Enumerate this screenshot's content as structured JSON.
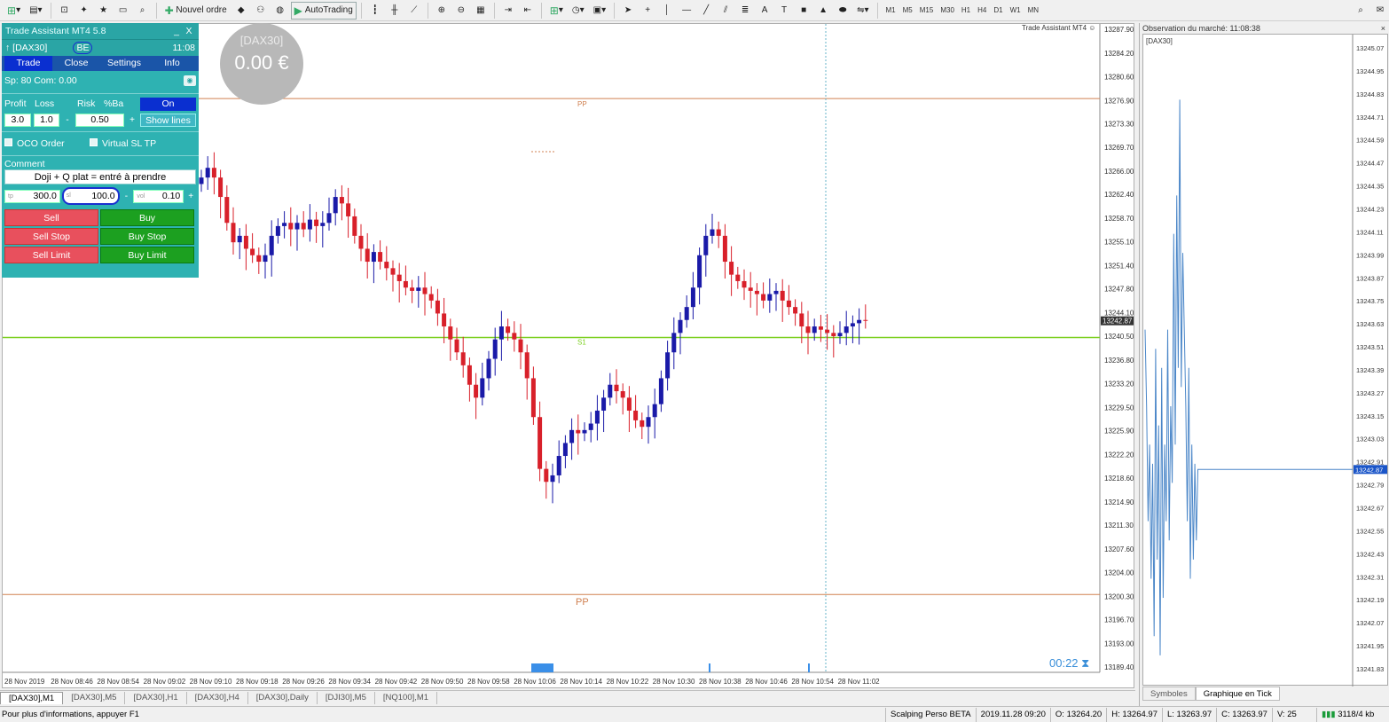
{
  "toolbar": {
    "new_order_label": "Nouvel ordre",
    "autotrading_label": "AutoTrading",
    "timeframes": [
      "M1",
      "M5",
      "M15",
      "M30",
      "H1",
      "H4",
      "D1",
      "W1",
      "MN"
    ]
  },
  "trade_assistant": {
    "title": "Trade Assistant MT4 5.8",
    "minimize": "_",
    "close": "X",
    "symbol": "[DAX30]",
    "be_label": "BE",
    "time": "11:08",
    "tabs": [
      "Trade",
      "Close",
      "Settings",
      "Info"
    ],
    "spread_text": "Sp: 80  Com: 0.00",
    "headers": {
      "profit": "Profit",
      "loss": "Loss",
      "risk": "Risk",
      "pct_ba": "%Ba"
    },
    "on_label": "On",
    "profit_value": "3.0",
    "loss_value": "1.0",
    "risk_minus": "-",
    "risk_value": "0.50",
    "risk_plus": "+",
    "show_lines_label": "Show lines",
    "oco_label": "OCO Order",
    "virtual_label": "Virtual SL TP",
    "comment_label": "Comment",
    "comment_value": "Doji + Q plat = entré à prendre",
    "tp_label": "tp",
    "tp_value": "300.0",
    "sl_label": "sl",
    "sl_value": "100.0",
    "vol_label": "vol",
    "vol_minus": "-",
    "vol_value": "0.10",
    "vol_plus": "+",
    "buttons": {
      "sell": "Sell",
      "buy": "Buy",
      "sell_stop": "Sell Stop",
      "buy_stop": "Buy Stop",
      "sell_limit": "Sell Limit",
      "buy_limit": "Buy Limit"
    }
  },
  "pnl_badge": {
    "symbol": "[DAX30]",
    "value": "0.00 €"
  },
  "chart": {
    "ea_label": "Trade Assistant MT4",
    "pp_top_label": "PP",
    "pp_bottom_label": "PP",
    "s1_label": "S1",
    "timer": "00:22",
    "current_price_label": "13242.87",
    "colors": {
      "bull": "#1a1aa8",
      "bear": "#d8202a",
      "pp": "#d08050",
      "s1": "#7cd020"
    },
    "y_ticks": [
      "13287.90",
      "13284.20",
      "13280.60",
      "13276.90",
      "13273.30",
      "13269.70",
      "13266.00",
      "13262.40",
      "13258.70",
      "13255.10",
      "13251.40",
      "13247.80",
      "13244.10",
      "13240.50",
      "13236.80",
      "13233.20",
      "13229.50",
      "13225.90",
      "13222.20",
      "13218.60",
      "13214.90",
      "13211.30",
      "13207.60",
      "13204.00",
      "13200.30",
      "13196.70",
      "13193.00",
      "13189.40"
    ],
    "x_ticks": [
      "28 Nov 2019",
      "28 Nov 08:46",
      "28 Nov 08:54",
      "28 Nov 09:02",
      "28 Nov 09:10",
      "28 Nov 09:18",
      "28 Nov 09:26",
      "28 Nov 09:34",
      "28 Nov 09:42",
      "28 Nov 09:50",
      "28 Nov 09:58",
      "28 Nov 10:06",
      "28 Nov 10:14",
      "28 Nov 10:22",
      "28 Nov 10:30",
      "28 Nov 10:38",
      "28 Nov 10:46",
      "28 Nov 10:54",
      "28 Nov 11:02"
    ]
  },
  "chart_data": {
    "type": "line",
    "title": "[DAX30],M1",
    "pivot_pp_top": 13277.2,
    "pivot_pp_bottom": 13200.6,
    "support_s1": 13240.3,
    "last_price": 13242.87,
    "closes": [
      13265,
      13266.5,
      13265,
      13262,
      13258,
      13255,
      13256,
      13254,
      13253,
      13252,
      13253,
      13256,
      13257.5,
      13258,
      13257,
      13258,
      13257,
      13258.5,
      13257.5,
      13258,
      13259.5,
      13262,
      13261,
      13259,
      13256,
      13254,
      13252,
      13253.5,
      13252,
      13251,
      13250,
      13249,
      13248,
      13247.5,
      13248,
      13247,
      13246,
      13244,
      13242,
      13240,
      13238,
      13236,
      13233,
      13231,
      13234,
      13237,
      13240,
      13242,
      13241,
      13240,
      13238,
      13234,
      13228,
      13220,
      13218,
      13219,
      13222,
      13224,
      13226,
      13225.5,
      13226,
      13227,
      13229,
      13231,
      13233,
      13232,
      13231,
      13229,
      13227.5,
      13226.5,
      13228,
      13230,
      13234,
      13238,
      13241,
      13243,
      13245,
      13248,
      13253,
      13256,
      13257,
      13256,
      13252,
      13250,
      13249,
      13248,
      13247.5,
      13247,
      13246,
      13247,
      13247.5,
      13246,
      13245,
      13244,
      13242,
      13241,
      13242,
      13241.5,
      13241,
      13240.5,
      13241,
      13242,
      13242.5,
      13243,
      13242.87
    ]
  },
  "bottom_tabs": [
    "[DAX30],M1",
    "[DAX30],M5",
    "[DAX30],H1",
    "[DAX30],H4",
    "[DAX30],Daily",
    "[DJI30],M5",
    "[NQ100],M1"
  ],
  "status": {
    "help": "Pour plus d'informations, appuyer F1",
    "profile": "Scalping Perso BETA",
    "datetime": "2019.11.28 09:20",
    "open": "O: 13264.20",
    "high": "H: 13264.97",
    "low": "L: 13263.97",
    "close": "C: 13263.97",
    "volume": "V: 25",
    "traffic": "3118/4 kb"
  },
  "market_watch": {
    "title": "Observation du marché: 11:08:38",
    "close": "×",
    "symbol": "[DAX30]",
    "tabs": [
      "Symboles",
      "Graphique en Tick"
    ],
    "current_label": "13242.87",
    "y_ticks": [
      "13245.07",
      "13244.95",
      "13244.83",
      "13244.71",
      "13244.59",
      "13244.47",
      "13244.35",
      "13244.23",
      "13244.11",
      "13243.99",
      "13243.87",
      "13243.75",
      "13243.63",
      "13243.51",
      "13243.39",
      "13243.27",
      "13243.15",
      "13243.03",
      "13242.91",
      "13242.79",
      "13242.67",
      "13242.55",
      "13242.43",
      "13242.31",
      "13242.19",
      "13242.07",
      "13241.95",
      "13241.83"
    ]
  }
}
